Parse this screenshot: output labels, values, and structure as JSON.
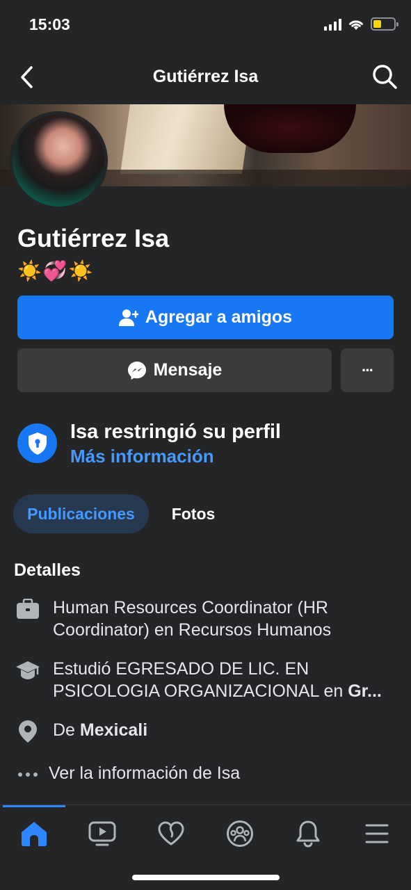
{
  "status_bar": {
    "time": "15:03"
  },
  "header": {
    "title": "Gutiérrez Isa"
  },
  "profile": {
    "name": "Gutiérrez Isa",
    "bio": "☀️💞☀️"
  },
  "actions": {
    "add_friend_label": "Agregar a amigos",
    "message_label": "Mensaje",
    "more_label": "···"
  },
  "restricted": {
    "title": "Isa restringió su perfil",
    "link": "Más información"
  },
  "tabs": [
    {
      "label": "Publicaciones",
      "selected": true
    },
    {
      "label": "Fotos",
      "selected": false
    }
  ],
  "details": {
    "title": "Detalles",
    "work": "Human Resources Coordinator (HR Coordinator) en Recursos Humanos",
    "education_line1": "Estudió EGRESADO DE LIC.  EN",
    "education_line2_prefix": "PSICOLOGIA ORGANIZACIONAL en ",
    "education_line2_bold": "Gr...",
    "hometown_prefix": "De ",
    "hometown_city": "Mexicali",
    "see_more": "Ver la información de Isa"
  },
  "bottom_nav": [
    {
      "icon": "home-icon",
      "active": true
    },
    {
      "icon": "video-icon",
      "active": false
    },
    {
      "icon": "dating-heart-icon",
      "active": false
    },
    {
      "icon": "groups-icon",
      "active": false
    },
    {
      "icon": "bell-icon",
      "active": false
    },
    {
      "icon": "menu-icon",
      "active": false
    }
  ],
  "colors": {
    "background": "#242526",
    "accent": "#1877f2",
    "link": "#4599ff",
    "secondary_button": "#3a3b3c"
  }
}
